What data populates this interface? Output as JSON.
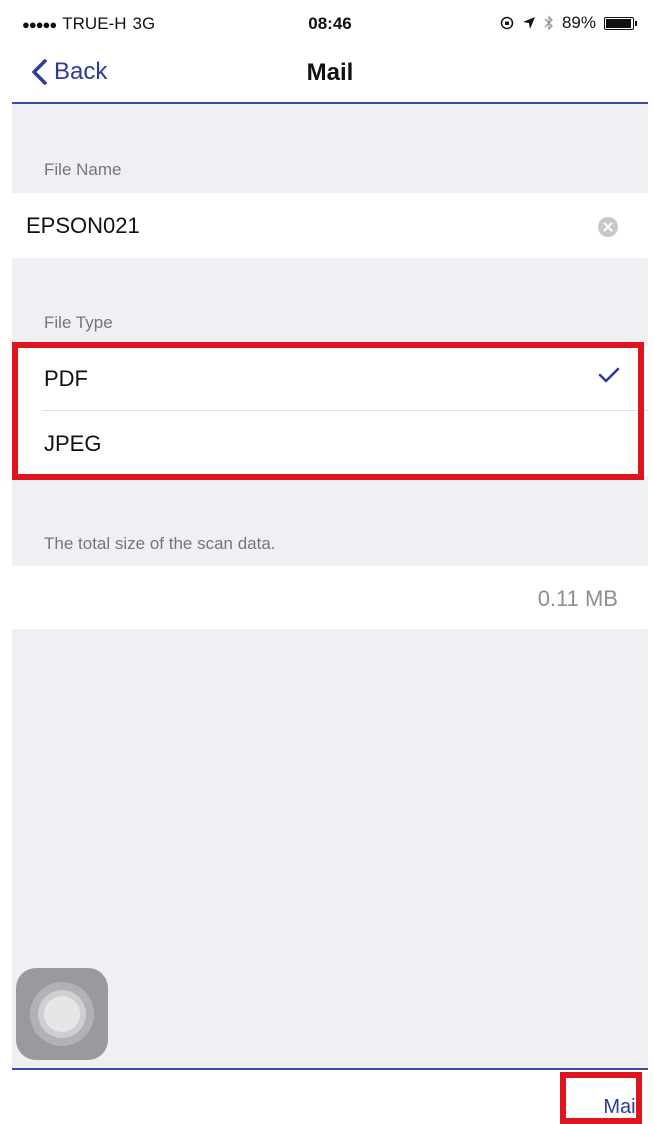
{
  "status_bar": {
    "signal": "●●●●●",
    "carrier": "TRUE-H",
    "network": "3G",
    "time": "08:46",
    "battery": "89%",
    "battery_level": 0.89
  },
  "nav": {
    "back_label": "Back",
    "title": "Mail"
  },
  "file_name": {
    "label": "File Name",
    "value": "EPSON021"
  },
  "file_type": {
    "label": "File Type",
    "options": [
      "PDF",
      "JPEG"
    ],
    "selected": "PDF"
  },
  "scan_size": {
    "label": "The total size of the scan data.",
    "value": "0.11 MB"
  },
  "toolbar": {
    "mail_label": "Mail"
  },
  "colors": {
    "accent": "#2b3a9c",
    "highlight": "#e0141e"
  }
}
